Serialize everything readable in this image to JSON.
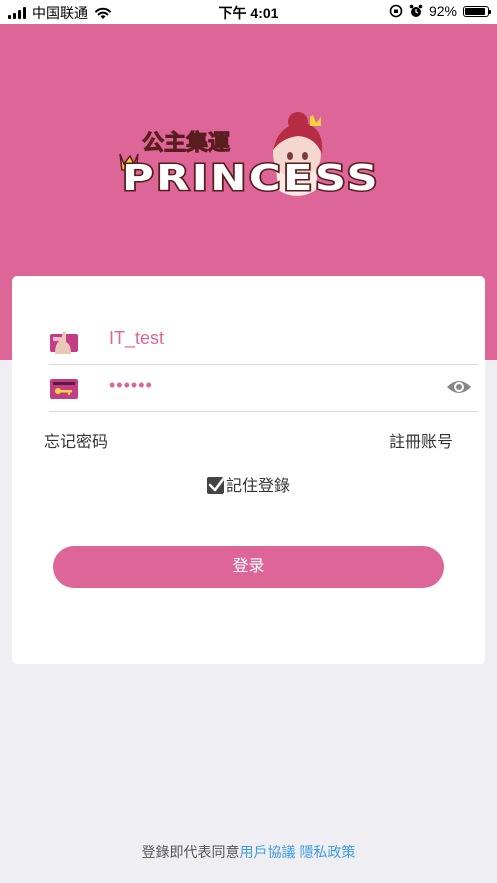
{
  "status_bar": {
    "carrier": "中国联通",
    "time": "下午 4:01",
    "battery": "92%",
    "battery_level": 0.92
  },
  "brand": {
    "title_cn": "公主集運",
    "title_en": "PRINCESS"
  },
  "login": {
    "username_value": "IT_test",
    "password_value": "••••••",
    "forgot_password": "忘记密码",
    "register": "註冊账号",
    "remember_label": "記住登錄",
    "remember_checked": true,
    "login_button": "登录"
  },
  "footer": {
    "prefix": "登錄即代表同意",
    "user_agreement": "用戶協議",
    "privacy_policy": "隱私政策"
  },
  "colors": {
    "brand_pink": "#de6597",
    "link_blue": "#3f9be6"
  }
}
